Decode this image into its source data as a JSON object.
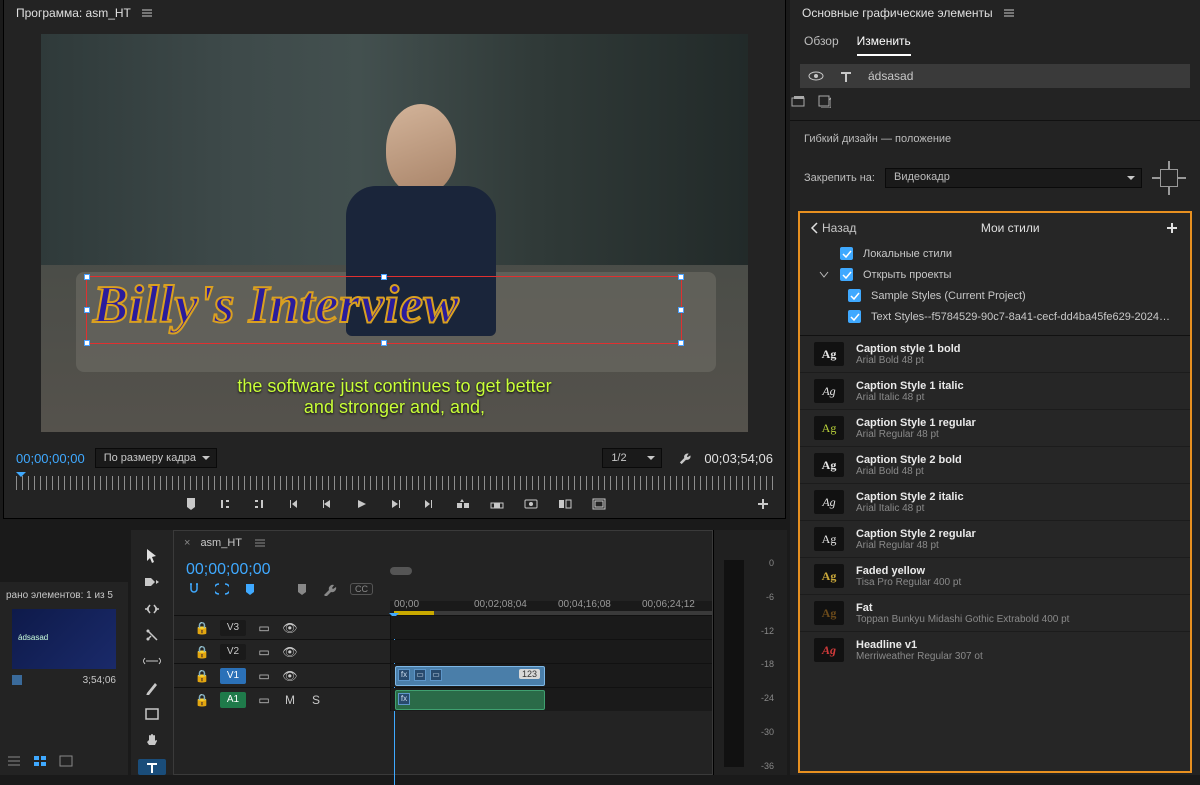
{
  "program": {
    "panel_title": "Программа: asm_HT",
    "title_text": "Billy's Interview",
    "caption_line1": "the software just continues to get better",
    "caption_line2": "and stronger and, and,",
    "tc_in": "00;00;00;00",
    "tc_out": "00;03;54;06",
    "fit_label": "По размеру кадра",
    "view_label": "1/2"
  },
  "timeline": {
    "seq_name": "asm_HT",
    "tc": "00;00;00;00",
    "ruler": [
      "00;00",
      "00;02;08;04",
      "00;04;16;08",
      "00;06;24;12"
    ],
    "tracks_v": [
      "V3",
      "V2",
      "V1"
    ],
    "tracks_a": [
      "A1"
    ],
    "clip_badge": "123"
  },
  "bin": {
    "header": "рано элементов: 1 из 5",
    "clip_label": "ádsasad",
    "duration": "3;54;06"
  },
  "meters": {
    "marks": [
      "0",
      "-6",
      "-12",
      "-18",
      "-24",
      "-30",
      "-36"
    ]
  },
  "eg": {
    "panel_title": "Основные графические элементы",
    "tab_browse": "Обзор",
    "tab_edit": "Изменить",
    "layer_name": "ádsasad",
    "responsive_title": "Гибкий дизайн — положение",
    "pin_label": "Закрепить на:",
    "pin_value": "Видеокадр"
  },
  "styles": {
    "back": "Назад",
    "title": "Мои стили",
    "local": "Локальные стили",
    "open": "Открыть проекты",
    "sample": "Sample Styles (Current Project)",
    "textstyles": "Text Styles--f5784529-90c7-8a41-cecf-dd4ba45fe629-2024-03-11...",
    "items": [
      {
        "name": "Caption style 1 bold",
        "detail": "Arial Bold 48 pt",
        "sw_color": "#e6e6e6",
        "sw_style": "font-weight:700"
      },
      {
        "name": "Caption Style 1 italic",
        "detail": "Arial Italic 48 pt",
        "sw_color": "#e6e6e6",
        "sw_style": "font-style:italic"
      },
      {
        "name": "Caption Style 1 regular",
        "detail": "Arial Regular 48 pt",
        "sw_color": "#b9d23a",
        "sw_style": ""
      },
      {
        "name": "Caption Style 2 bold",
        "detail": "Arial Bold 48 pt",
        "sw_color": "#e6e6e6",
        "sw_style": "font-weight:700"
      },
      {
        "name": "Caption Style 2 italic",
        "detail": "Arial Italic 48 pt",
        "sw_color": "#e6e6e6",
        "sw_style": "font-style:italic"
      },
      {
        "name": "Caption Style 2 regular",
        "detail": "Arial Regular 48 pt",
        "sw_color": "#e6e6e6",
        "sw_style": ""
      },
      {
        "name": "Faded yellow",
        "detail": "Tisa Pro Regular 400 pt",
        "sw_color": "#caa83a",
        "sw_style": "font-weight:700"
      },
      {
        "name": "Fat",
        "detail": "Toppan Bunkyu Midashi Gothic Extrabold 400 pt",
        "sw_color": "#6b4a1a",
        "sw_style": "font-weight:900"
      },
      {
        "name": "Headline v1",
        "detail": "Merriweather Regular 307 ot",
        "sw_color": "#d03a3a",
        "sw_style": "font-style:italic;font-weight:700"
      }
    ]
  }
}
